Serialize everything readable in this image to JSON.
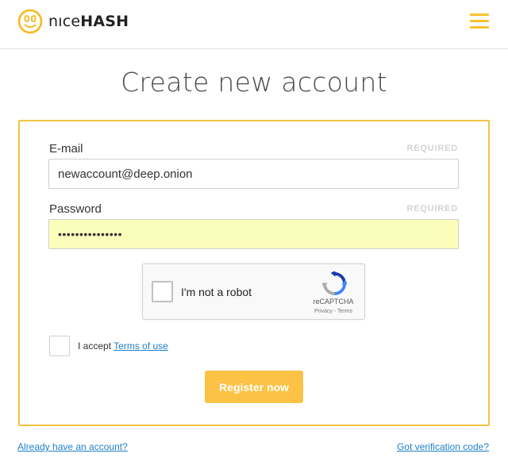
{
  "header": {
    "logo_text_light": "nıce",
    "logo_text_bold": "HASH",
    "menu_icon": "hamburger-menu-icon",
    "logo_icon": "nicehash-smiley-logo-icon",
    "colors": {
      "accent": "#fbc245",
      "link": "#1f7fc8",
      "border": "#f5c242"
    }
  },
  "page": {
    "title": "Create new account"
  },
  "form": {
    "email": {
      "label": "E-mail",
      "required": "REQUIRED",
      "value": "newaccount@deep.onion"
    },
    "password": {
      "label": "Password",
      "required": "REQUIRED",
      "value": "•••••••••••••••"
    },
    "recaptcha": {
      "label": "I'm not a robot",
      "brand": "reCAPTCHA",
      "links": "Privacy - Terms",
      "icon": "recaptcha-logo-icon"
    },
    "terms": {
      "prefix": "I accept",
      "link": "Terms of use"
    },
    "submit_label": "Register now"
  },
  "footer": {
    "left_link": "Already have an account?",
    "right_link": "Got verification code?"
  }
}
